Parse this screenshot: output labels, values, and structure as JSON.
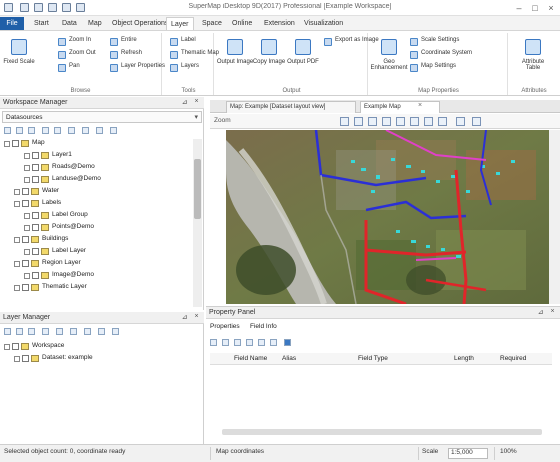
{
  "titlebar": {
    "title": "SuperMap iDesktop 9D(2017) Professional [Example Workspace]"
  },
  "ribbon_tabs": [
    "File",
    "Start",
    "Data",
    "Map",
    "Object Operations",
    "Layer",
    "Space",
    "Online",
    "Extension",
    "Visualization"
  ],
  "ribbon": {
    "groups": [
      {
        "label": "Browse",
        "big": "Fixed Scale",
        "small": [
          "Zoom In",
          "Zoom Out",
          "Pan",
          "Entire",
          "Refresh",
          "Layer Properties"
        ]
      },
      {
        "label": "Tools",
        "small": [
          "Label",
          "Thematic Map",
          "Layers"
        ]
      },
      {
        "label": "Output",
        "big": [
          "Output Image",
          "Copy Image",
          "Output PDF"
        ],
        "small": [
          "Export as Image"
        ]
      },
      {
        "label": "Map Properties",
        "big": [
          "Geo Enhancement"
        ],
        "small": [
          "Scale Settings",
          "Coordinate System",
          "Map Settings"
        ]
      },
      {
        "label": "Attributes",
        "big": [
          "Attribute Table"
        ]
      }
    ]
  },
  "left_panel": {
    "title": "Workspace Manager",
    "dropdown": "Datasources",
    "tree": [
      {
        "label": "Map",
        "level": 0
      },
      {
        "label": "Layer1",
        "level": 2
      },
      {
        "label": "Roads@Demo",
        "level": 2
      },
      {
        "label": "Landuse@Demo",
        "level": 2
      },
      {
        "label": "Water",
        "level": 1
      },
      {
        "label": "Labels",
        "level": 1
      },
      {
        "label": "Label Group",
        "level": 2
      },
      {
        "label": "Points@Demo",
        "level": 2
      },
      {
        "label": "Buildings",
        "level": 1
      },
      {
        "label": "Label Layer",
        "level": 2
      },
      {
        "label": "Region Layer",
        "level": 1
      },
      {
        "label": "Image@Demo",
        "level": 2
      },
      {
        "label": "Thematic Layer",
        "level": 1
      }
    ]
  },
  "layers_panel": {
    "title": "Layer Manager",
    "tree": [
      {
        "label": "Workspace",
        "level": 0
      },
      {
        "label": "Dataset: example",
        "level": 1
      }
    ]
  },
  "doc_tabs": [
    {
      "label": "Map: Example [Dataset layout view]",
      "active": false
    },
    {
      "label": "Example Map",
      "active": true
    }
  ],
  "map_toolbar": {
    "label": "Zoom"
  },
  "bottom_panel": {
    "title": "Property Panel",
    "tabs": [
      "Properties",
      "Field Info"
    ],
    "columns": [
      "Field Name",
      "Alias",
      "Field Type",
      "Length",
      "Required"
    ]
  },
  "status": {
    "left": "Selected object count: 0, coordinate ready",
    "mid": "Map coordinates",
    "right1": "Scale",
    "right2": "1:5,000",
    "zoom": "100%"
  },
  "colors": {
    "file_tab": "#1f5fa8",
    "map_road_red": "#e0252a",
    "map_road_blue": "#2b2fd6",
    "map_road_magenta": "#e040c8",
    "map_cyan": "#38d8d8"
  }
}
